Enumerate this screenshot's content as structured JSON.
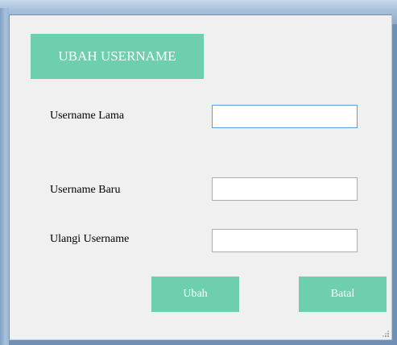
{
  "dialog": {
    "title": "UBAH USERNAME"
  },
  "form": {
    "old_username_label": "Username Lama",
    "old_username_value": "",
    "new_username_label": "Username Baru",
    "new_username_value": "",
    "confirm_username_label": "Ulangi Username",
    "confirm_username_value": ""
  },
  "actions": {
    "submit_label": "Ubah",
    "cancel_label": "Batal"
  },
  "colors": {
    "accent": "#6dcfad",
    "frame": "#8fabcb",
    "client_bg": "#f0f0f0",
    "focus_border": "#569de5"
  },
  "icons": {
    "resize_grip": "resize-grip-icon"
  }
}
